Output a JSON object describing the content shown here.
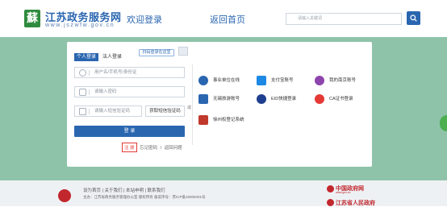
{
  "header": {
    "logo_glyph": "蘇",
    "logo_title": "江苏政务服务网",
    "logo_url": "www.jszwfw.gov.cn",
    "nav_welcome": "欢迎登录",
    "nav_home": "返回首页",
    "search_placeholder": "请输入关键词"
  },
  "login": {
    "tab_person": "个人登录",
    "tab_legal": "法人登录",
    "qr_link": "扫码登录在这里",
    "username_placeholder": "用户名/手机号/身份证",
    "password_placeholder": "请输入密码",
    "sms_placeholder": "请输入短信验证码",
    "sms_button": "获取短信验证码",
    "or_text": "或",
    "login_button": "登 录",
    "register": "注 册",
    "forgot": "忘记密码",
    "sep": "/",
    "back": "返回问题"
  },
  "options": [
    {
      "label": "事业单位在线",
      "icon": "building-icon",
      "color": "#2a66b0"
    },
    {
      "label": "支付宝账号",
      "icon": "alipay-icon",
      "color": "#1e88e5"
    },
    {
      "label": "我的南京账号",
      "icon": "nanjing-icon",
      "color": "#8e44ad"
    },
    {
      "label": "无锡旅游账号",
      "icon": "wuxi-icon",
      "color": "#2a66b0"
    },
    {
      "label": "EID快捷登录",
      "icon": "eid-icon",
      "color": "#1e3f8f"
    },
    {
      "label": "CA证书登录",
      "icon": "ca-icon",
      "color": "#e53935"
    },
    {
      "label": "徐州权登记系统",
      "icon": "xuzhou-icon",
      "color": "#c0392b"
    }
  ],
  "footer": {
    "links": "设为首页 | 关于我们 | 本站申明 | 联系我们",
    "host": "主办：江苏省政务服务管理办公室 版权所有   备案序号：苏ICP备15009401号",
    "gov_badge": "中国政府网",
    "gov_sub": "www.gov.cn",
    "js_badge": "江苏省人民政府"
  }
}
